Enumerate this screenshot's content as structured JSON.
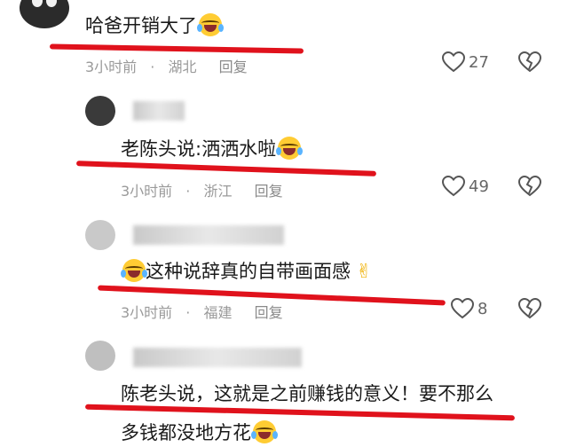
{
  "comments": [
    {
      "text": "哈爸开销大了",
      "time": "3小时前",
      "location": "湖北",
      "reply": "回复",
      "likes": "27"
    },
    {
      "text": "老陈头说:洒洒水啦",
      "time": "3小时前",
      "location": "浙江",
      "reply": "回复",
      "likes": "49"
    },
    {
      "text": "这种说辞真的自带画面感",
      "time": "3小时前",
      "location": "福建",
      "reply": "回复",
      "likes": "8"
    },
    {
      "text1": "陈老头说，这就是之前赚钱的意义！要不那么",
      "text2": "多钱都没地方花"
    }
  ],
  "icons": {
    "heart": "heart-outline-icon",
    "dislike": "broken-heart-icon",
    "emoji1": "crying-laughing-emoji",
    "emoji2": "finger-heart-emoji"
  },
  "colors": {
    "underline": "#e0121c",
    "meta": "#9a9a9a"
  }
}
